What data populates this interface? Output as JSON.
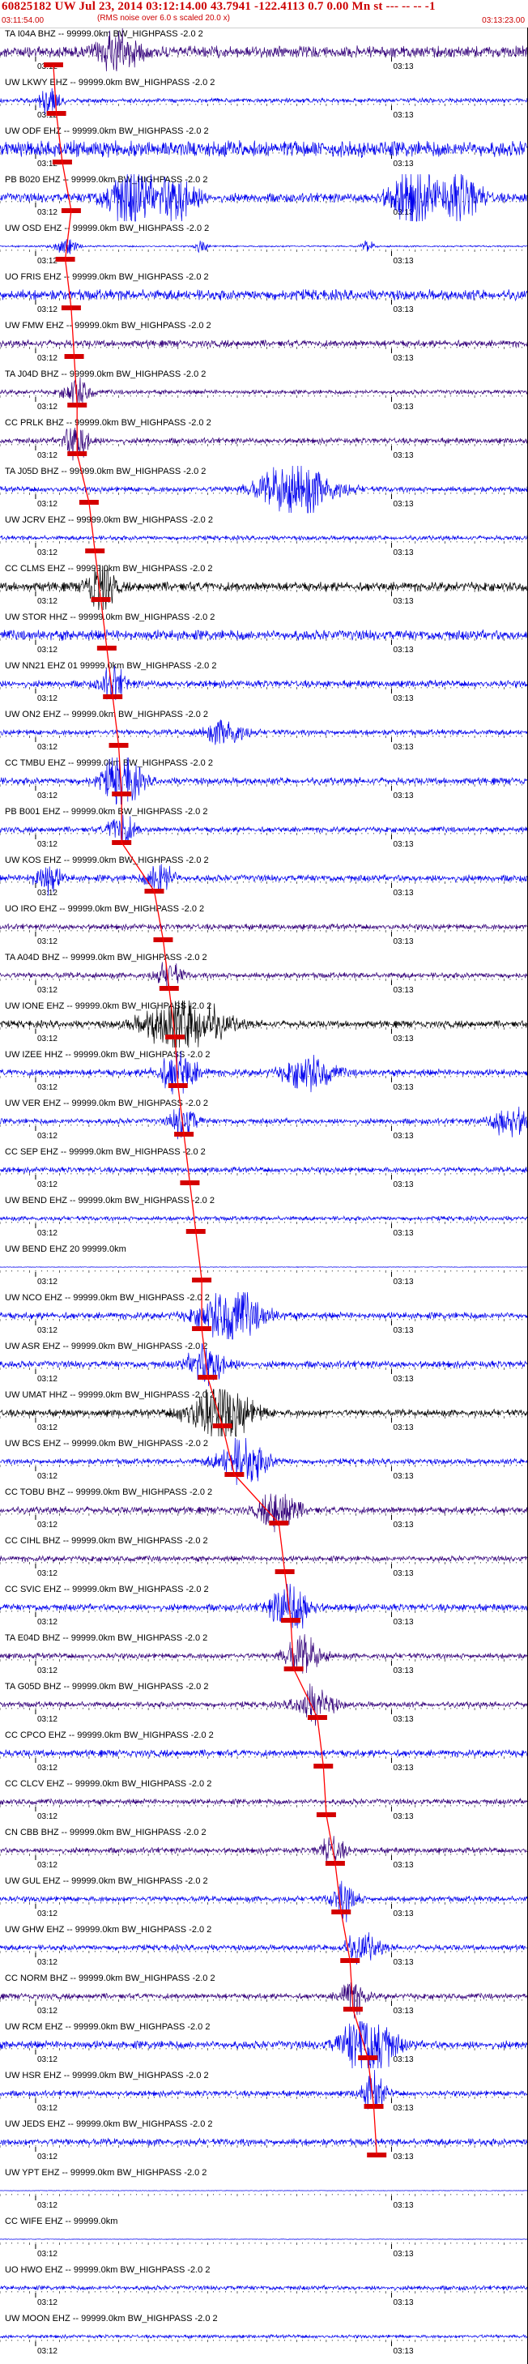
{
  "header": {
    "title": "60825182 UW Jul 23, 2014 03:12:14.00   43.7941 -122.4113  0.7 0.00 Mn st --- -- -- -1",
    "subtitle": "(RMS noise over 6.0 s scaled 20.0 x)",
    "start_time": "03:11:54.00",
    "end_time": "03:13:23.00"
  },
  "colors": {
    "trace_blue": "#0000ee",
    "trace_purple": "#33007a",
    "trace_black": "#000000",
    "pick_red": "#ff0000",
    "marker_red": "#d40000",
    "text": "#000000",
    "header_red": "#cc0000"
  },
  "chart_data": {
    "type": "seismogram",
    "time_axis": {
      "start": "03:11:54.00",
      "end": "03:13:23.00",
      "ticks": [
        {
          "label": "03:12",
          "seconds_after_start": 6
        },
        {
          "label": "03:13",
          "seconds_after_start": 66
        }
      ]
    },
    "traces": [
      {
        "label": "TA I04A BHZ -- 99999.0km BW_HIGHPASS -2.0  2",
        "color": "purple",
        "amp": 1.0,
        "pick": 9,
        "bursts": [
          [
            20,
            3,
            1.2
          ]
        ]
      },
      {
        "label": "UW LKWY EHZ -- 99999.0km BW_HIGHPASS -2.0  2",
        "color": "blue",
        "amp": 0.4,
        "pick": 9.5,
        "bursts": [
          [
            8.5,
            1.5,
            2.5
          ]
        ]
      },
      {
        "label": "UW ODF EHZ -- 99999.0km BW_HIGHPASS -2.0  2",
        "color": "blue",
        "amp": 1.4,
        "pick": 10.5,
        "bursts": []
      },
      {
        "label": "PB B020 EHZ -- 99999.0km BW_HIGHPASS -2.0  2",
        "color": "blue",
        "amp": 0.8,
        "pick": 12,
        "bursts": [
          [
            22,
            4,
            2.0
          ],
          [
            30,
            3,
            1.8
          ],
          [
            70,
            4,
            2.0
          ],
          [
            78,
            3,
            1.6
          ]
        ]
      },
      {
        "label": "UW OSD EHZ -- 99999.0km BW_HIGHPASS -2.0  2",
        "color": "blue",
        "amp": 0.15,
        "pick": 11,
        "bursts": [
          [
            11,
            2,
            3.0
          ],
          [
            34,
            1,
            2.5
          ],
          [
            62,
            1,
            2.0
          ]
        ]
      },
      {
        "label": "UO FRIS EHZ -- 99999.0km BW_HIGHPASS -2.0  2",
        "color": "blue",
        "amp": 0.9,
        "pick": 12,
        "bursts": []
      },
      {
        "label": "UW FMW EHZ -- 99999.0km BW_HIGHPASS -2.0  2",
        "color": "purple",
        "amp": 0.6,
        "pick": 12.5,
        "bursts": []
      },
      {
        "label": "TA J04D BHZ -- 99999.0km BW_HIGHPASS -2.0  2",
        "color": "purple",
        "amp": 0.4,
        "pick": 13,
        "bursts": [
          [
            13,
            2,
            2.0
          ]
        ]
      },
      {
        "label": "CC PRLK BHZ -- 99999.0km BW_HIGHPASS -2.0  2",
        "color": "purple",
        "amp": 0.5,
        "pick": 13,
        "bursts": [
          [
            13,
            2,
            2.5
          ]
        ]
      },
      {
        "label": "TA J05D BHZ -- 99999.0km BW_HIGHPASS -2.0  2",
        "color": "blue",
        "amp": 0.5,
        "pick": 15,
        "bursts": [
          [
            50,
            6,
            3.0
          ]
        ]
      },
      {
        "label": "UW JCRV EHZ -- 99999.0km BW_HIGHPASS -2.0  2",
        "color": "blue",
        "amp": 0.4,
        "pick": 16,
        "bursts": []
      },
      {
        "label": "CC CLMS EHZ -- 99999.0km BW_HIGHPASS -2.0  2",
        "color": "black",
        "amp": 0.8,
        "pick": 17,
        "bursts": [
          [
            17,
            2,
            2.0
          ]
        ]
      },
      {
        "label": "UW STOR HHZ -- 99999.0km BW_HIGHPASS -2.0  2",
        "color": "blue",
        "amp": 0.9,
        "pick": 18,
        "bursts": []
      },
      {
        "label": "UW NN21 EHZ 01 99999.0km BW_HIGHPASS -2.0  2",
        "color": "blue",
        "amp": 0.6,
        "pick": 19,
        "bursts": [
          [
            19,
            2,
            1.5
          ]
        ]
      },
      {
        "label": "UW ON2 EHZ -- 99999.0km BW_HIGHPASS -2.0  2",
        "color": "blue",
        "amp": 0.5,
        "pick": 20,
        "bursts": [
          [
            38,
            3,
            1.5
          ]
        ]
      },
      {
        "label": "CC TMBU EHZ -- 99999.0km BW_HIGHPASS -2.0  2",
        "color": "blue",
        "amp": 0.6,
        "pick": 20.5,
        "bursts": [
          [
            20.5,
            3,
            2.5
          ]
        ]
      },
      {
        "label": "PB B001 EHZ -- 99999.0km BW_HIGHPASS -2.0  2",
        "color": "blue",
        "amp": 0.5,
        "pick": 20.5,
        "bursts": [
          [
            20.5,
            2,
            2.0
          ]
        ]
      },
      {
        "label": "UW KOS EHZ -- 99999.0km BW_HIGHPASS -2.0  2",
        "color": "blue",
        "amp": 0.6,
        "pick": 26,
        "bursts": [
          [
            27,
            2,
            1.8
          ],
          [
            8,
            2,
            1.5
          ]
        ]
      },
      {
        "label": "UO IRO EHZ -- 99999.0km BW_HIGHPASS -2.0  2",
        "color": "purple",
        "amp": 0.5,
        "pick": 27.5,
        "bursts": []
      },
      {
        "label": "TA A04D BHZ -- 99999.0km BW_HIGHPASS -2.0  2",
        "color": "purple",
        "amp": 0.5,
        "pick": 28.5,
        "bursts": [
          [
            28.5,
            2,
            1.5
          ]
        ]
      },
      {
        "label": "UW IONE EHZ -- 99999.0km BW_HIGHPASS -2.0  2",
        "color": "black",
        "amp": 0.6,
        "pick": 29.5,
        "bursts": [
          [
            31,
            6,
            3.0
          ]
        ]
      },
      {
        "label": "UW IZEE HHZ -- 99999.0km BW_HIGHPASS -2.0  2",
        "color": "blue",
        "amp": 0.6,
        "pick": 30,
        "bursts": [
          [
            30,
            3,
            2.0
          ],
          [
            52,
            4,
            1.5
          ]
        ]
      },
      {
        "label": "UW VER EHZ -- 99999.0km BW_HIGHPASS -2.0  2",
        "color": "blue",
        "amp": 0.5,
        "pick": 31,
        "bursts": [
          [
            31,
            2,
            2.0
          ],
          [
            86,
            3,
            1.8
          ]
        ]
      },
      {
        "label": "CC SEP EHZ -- 99999.0km BW_HIGHPASS -2.0  2",
        "color": "blue",
        "amp": 0.5,
        "pick": 32,
        "bursts": []
      },
      {
        "label": "UW BEND EHZ -- 99999.0km BW_HIGHPASS -2.0  2",
        "color": "blue",
        "amp": 0.4,
        "pick": 33,
        "bursts": []
      },
      {
        "label": "UW BEND EHZ 20 99999.0km",
        "color": "blue",
        "amp": 0.05,
        "pick": 34,
        "bursts": []
      },
      {
        "label": "UW NCO EHZ -- 99999.0km BW_HIGHPASS -2.0  2",
        "color": "blue",
        "amp": 0.6,
        "pick": 34,
        "bursts": [
          [
            39,
            5,
            2.5
          ]
        ]
      },
      {
        "label": "UW ASR EHZ -- 99999.0km BW_HIGHPASS -2.0  2",
        "color": "blue",
        "amp": 0.6,
        "pick": 35,
        "bursts": [
          [
            35,
            3,
            2.0
          ]
        ]
      },
      {
        "label": "UW UMAT HHZ -- 99999.0km BW_HIGHPASS -2.0  2",
        "color": "black",
        "amp": 0.6,
        "pick": 37.5,
        "bursts": [
          [
            37,
            5,
            3.0
          ]
        ]
      },
      {
        "label": "UW BCS EHZ -- 99999.0km BW_HIGHPASS -2.0  2",
        "color": "blue",
        "amp": 0.5,
        "pick": 39.5,
        "bursts": [
          [
            41,
            4,
            2.5
          ]
        ]
      },
      {
        "label": "CC TOBU BHZ -- 99999.0km BW_HIGHPASS -2.0  2",
        "color": "purple",
        "amp": 0.6,
        "pick": 47,
        "bursts": [
          [
            47,
            3,
            2.0
          ]
        ]
      },
      {
        "label": "CC CIHL BHZ -- 99999.0km BW_HIGHPASS -2.0  2",
        "color": "purple",
        "amp": 0.5,
        "pick": 48,
        "bursts": []
      },
      {
        "label": "CC SVIC EHZ -- 99999.0km BW_HIGHPASS -2.0  2",
        "color": "blue",
        "amp": 0.6,
        "pick": 49,
        "bursts": [
          [
            49,
            3,
            2.5
          ]
        ]
      },
      {
        "label": "TA E04D BHZ -- 99999.0km BW_HIGHPASS -2.0  2",
        "color": "purple",
        "amp": 0.5,
        "pick": 49.5,
        "bursts": [
          [
            51,
            3,
            2.0
          ]
        ]
      },
      {
        "label": "TA G05D BHZ -- 99999.0km BW_HIGHPASS -2.0  2",
        "color": "purple",
        "amp": 0.5,
        "pick": 53.5,
        "bursts": [
          [
            53,
            3,
            2.0
          ]
        ]
      },
      {
        "label": "CC CPCO EHZ -- 99999.0km BW_HIGHPASS -2.0  2",
        "color": "blue",
        "amp": 0.6,
        "pick": 54.5,
        "bursts": []
      },
      {
        "label": "CC CLCV EHZ -- 99999.0km BW_HIGHPASS -2.0  2",
        "color": "purple",
        "amp": 0.5,
        "pick": 55,
        "bursts": []
      },
      {
        "label": "CN CBB BHZ -- 99999.0km BW_HIGHPASS -2.0  2",
        "color": "purple",
        "amp": 0.5,
        "pick": 56.5,
        "bursts": [
          [
            56,
            2,
            1.5
          ]
        ]
      },
      {
        "label": "UW GUL EHZ -- 99999.0km BW_HIGHPASS -2.0  2",
        "color": "blue",
        "amp": 0.5,
        "pick": 57.5,
        "bursts": [
          [
            58,
            2,
            2.0
          ]
        ]
      },
      {
        "label": "UW GHW EHZ -- 99999.0km BW_HIGHPASS -2.0  2",
        "color": "blue",
        "amp": 0.5,
        "pick": 59,
        "bursts": [
          [
            61,
            3,
            1.5
          ]
        ]
      },
      {
        "label": "CC NORM BHZ -- 99999.0km BW_HIGHPASS -2.0  2",
        "color": "purple",
        "amp": 0.5,
        "pick": 59.5,
        "bursts": [
          [
            59.5,
            2,
            2.0
          ]
        ]
      },
      {
        "label": "UW RCM EHZ -- 99999.0km BW_HIGHPASS -2.0  2",
        "color": "blue",
        "amp": 0.7,
        "pick": 62,
        "bursts": [
          [
            62,
            4,
            3.0
          ]
        ]
      },
      {
        "label": "UW HSR EHZ -- 99999.0km BW_HIGHPASS -2.0  2",
        "color": "blue",
        "amp": 0.5,
        "pick": 63,
        "bursts": [
          [
            63,
            2,
            2.0
          ]
        ]
      },
      {
        "label": "UW JEDS EHZ -- 99999.0km BW_HIGHPASS -2.0  2",
        "color": "blue",
        "amp": 0.6,
        "pick": 63.5,
        "bursts": []
      },
      {
        "label": "UW YPT EHZ -- 99999.0km BW_HIGHPASS -2.0  2",
        "color": "blue",
        "amp": 0.05,
        "pick": null,
        "bursts": []
      },
      {
        "label": "CC WIFE EHZ -- 99999.0km",
        "color": "blue",
        "amp": 0.05,
        "pick": null,
        "bursts": []
      },
      {
        "label": "UO HWO EHZ -- 99999.0km BW_HIGHPASS -2.0  2",
        "color": "blue",
        "amp": 0.4,
        "pick": null,
        "bursts": []
      },
      {
        "label": "UW MOON EHZ -- 99999.0km BW_HIGHPASS -2.0  2",
        "color": "blue",
        "amp": 0.3,
        "pick": null,
        "bursts": []
      }
    ]
  }
}
